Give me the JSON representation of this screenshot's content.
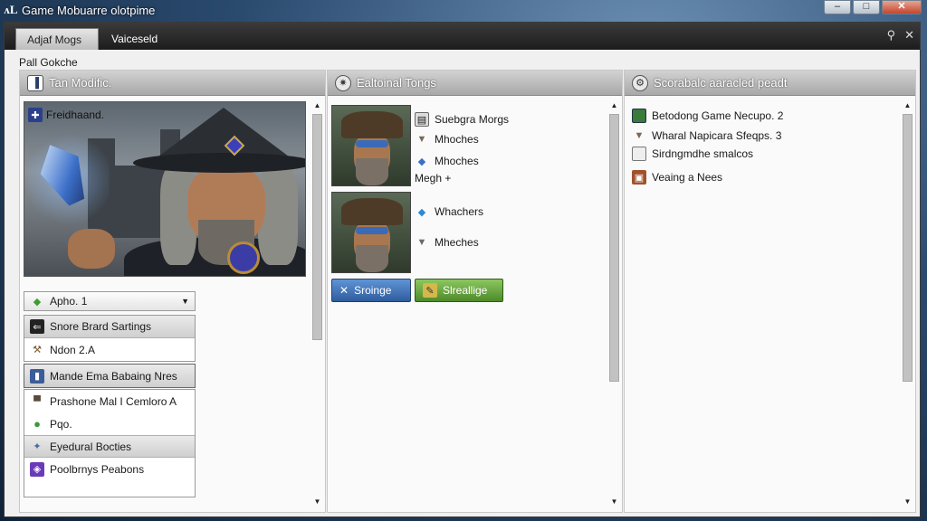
{
  "titlebar": {
    "title": "Game Mobuarre olotpime",
    "app_icon_glyph": "ᴧL"
  },
  "window_controls": {
    "minimize": "–",
    "maximize": "□",
    "close": "✕"
  },
  "tabs": [
    {
      "label": "Adjaf Mogs"
    },
    {
      "label": "Vaiceseld"
    }
  ],
  "tab_icons": {
    "pin": "⚲",
    "close": "✕"
  },
  "section_label": "Pall Gokche",
  "left_panel": {
    "header": "Tan Modific.",
    "hero_label": "Freidhaand.",
    "dropdown_value": "Apho. 1",
    "list_a": [
      {
        "label": "Snore Brard Sartings",
        "icon": "arrow-left-icon"
      },
      {
        "label": "Ndon 2.A",
        "icon": "hammer-icon"
      }
    ],
    "list_b_header": "Mande Ema Babaing Nres",
    "list_b": [
      {
        "label": "Prashone Mal I Cemloro A",
        "icon": "anvil-icon"
      },
      {
        "label": "Pqo.",
        "icon": "circle-icon"
      },
      {
        "label": "Eyedural Bocties",
        "icon": "star-icon"
      },
      {
        "label": "Poolbrnys Peabons",
        "icon": "gem-icon"
      }
    ]
  },
  "middle_panel": {
    "header": "Ealtoinal Tongs",
    "items_top": [
      {
        "label": "Suebgra Morgs",
        "icon": "scroll-icon"
      },
      {
        "label": "Mhoches",
        "icon": "anvil-icon"
      },
      {
        "label": "Mhoches",
        "icon": "potion-icon"
      },
      {
        "label": "Megh +",
        "icon": ""
      }
    ],
    "items_bottom": [
      {
        "label": "Whachers",
        "icon": "gem-icon"
      },
      {
        "label": "Mheches",
        "icon": "anvil-icon"
      }
    ],
    "button_blue": "Sroinge",
    "button_green": "Slreallige"
  },
  "right_panel": {
    "header": "Scorabalc aaracled peadt",
    "items": [
      {
        "label": "Betodong Game Necupo. 2",
        "icon": "image-icon"
      },
      {
        "label": "Wharal Napicara Sfeqps. 3",
        "icon": "anvil-icon"
      },
      {
        "label": "Sirdngmdhe smalcos",
        "icon": "file-icon"
      },
      {
        "label": "Veaing a Nees",
        "icon": "box-icon"
      }
    ]
  }
}
